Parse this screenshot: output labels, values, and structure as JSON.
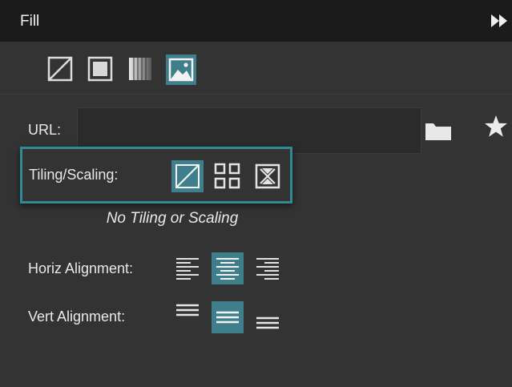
{
  "panel": {
    "title": "Fill"
  },
  "fill_types": [
    {
      "name": "none",
      "icon": "no-fill-icon",
      "selected": false
    },
    {
      "name": "solid",
      "icon": "solid-fill-icon",
      "selected": false
    },
    {
      "name": "gradient",
      "icon": "gradient-fill-icon",
      "selected": false
    },
    {
      "name": "image",
      "icon": "image-fill-icon",
      "selected": true
    }
  ],
  "url": {
    "label": "URL:",
    "value": "",
    "placeholder": ""
  },
  "tiling": {
    "label": "Tiling/Scaling:",
    "options": [
      "no-tiling-icon",
      "tile-grid-icon",
      "scale-to-fit-icon"
    ],
    "selected": "no-tiling-icon",
    "hint": "No Tiling or Scaling"
  },
  "horiz_alignment": {
    "label": "Horiz Alignment:",
    "options": [
      "align-left-icon",
      "align-center-icon",
      "align-right-icon"
    ],
    "selected": "align-center-icon"
  },
  "vert_alignment": {
    "label": "Vert Alignment:",
    "options": [
      "align-top-icon",
      "align-middle-icon",
      "align-bottom-icon"
    ],
    "selected": "align-middle-icon"
  },
  "colors": {
    "header_bg": "#1b1b1b",
    "panel_bg": "#333333",
    "accent": "#2f8a96",
    "selected_button": "#3f7f8c",
    "text": "#e9e9e9"
  }
}
